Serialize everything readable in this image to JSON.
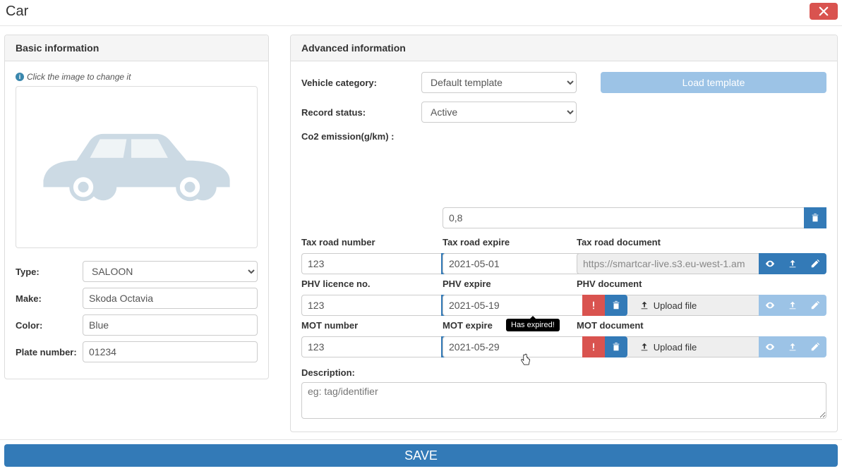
{
  "modal": {
    "title": "Car"
  },
  "basic": {
    "heading": "Basic information",
    "hint": "Click the image to change it",
    "type_label": "Type:",
    "type_value": "SALOON",
    "make_label": "Make:",
    "make_value": "Skoda Octavia",
    "color_label": "Color:",
    "color_value": "Blue",
    "plate_label": "Plate number:",
    "plate_value": "01234"
  },
  "advanced": {
    "heading": "Advanced information",
    "vehicle_category_label": "Vehicle category:",
    "vehicle_category_value": "Default template",
    "load_template_label": "Load template",
    "record_status_label": "Record status:",
    "record_status_value": "Active",
    "co2_label": "Co2 emission(g/km) :",
    "co2_value": "0,8",
    "cols": {
      "tax_number": "Tax road number",
      "tax_expire": "Tax road expire",
      "tax_doc": "Tax road document",
      "phv_number": "PHV licence no.",
      "phv_expire": "PHV expire",
      "phv_doc": "PHV document",
      "mot_number": "MOT number",
      "mot_expire": "MOT expire",
      "mot_doc": "MOT document"
    },
    "values": {
      "tax_number": "123",
      "tax_expire": "2021-05-01",
      "tax_doc": "https://smartcar-live.s3.eu-west-1.am",
      "phv_number": "123",
      "phv_expire": "2021-05-19",
      "mot_number": "123",
      "mot_expire": "2021-05-29"
    },
    "upload_label": "Upload file",
    "description_label": "Description:",
    "description_placeholder": "eg: tag/identifier",
    "tooltip_expired": "Has expired!"
  },
  "footer": {
    "save_label": "SAVE"
  }
}
